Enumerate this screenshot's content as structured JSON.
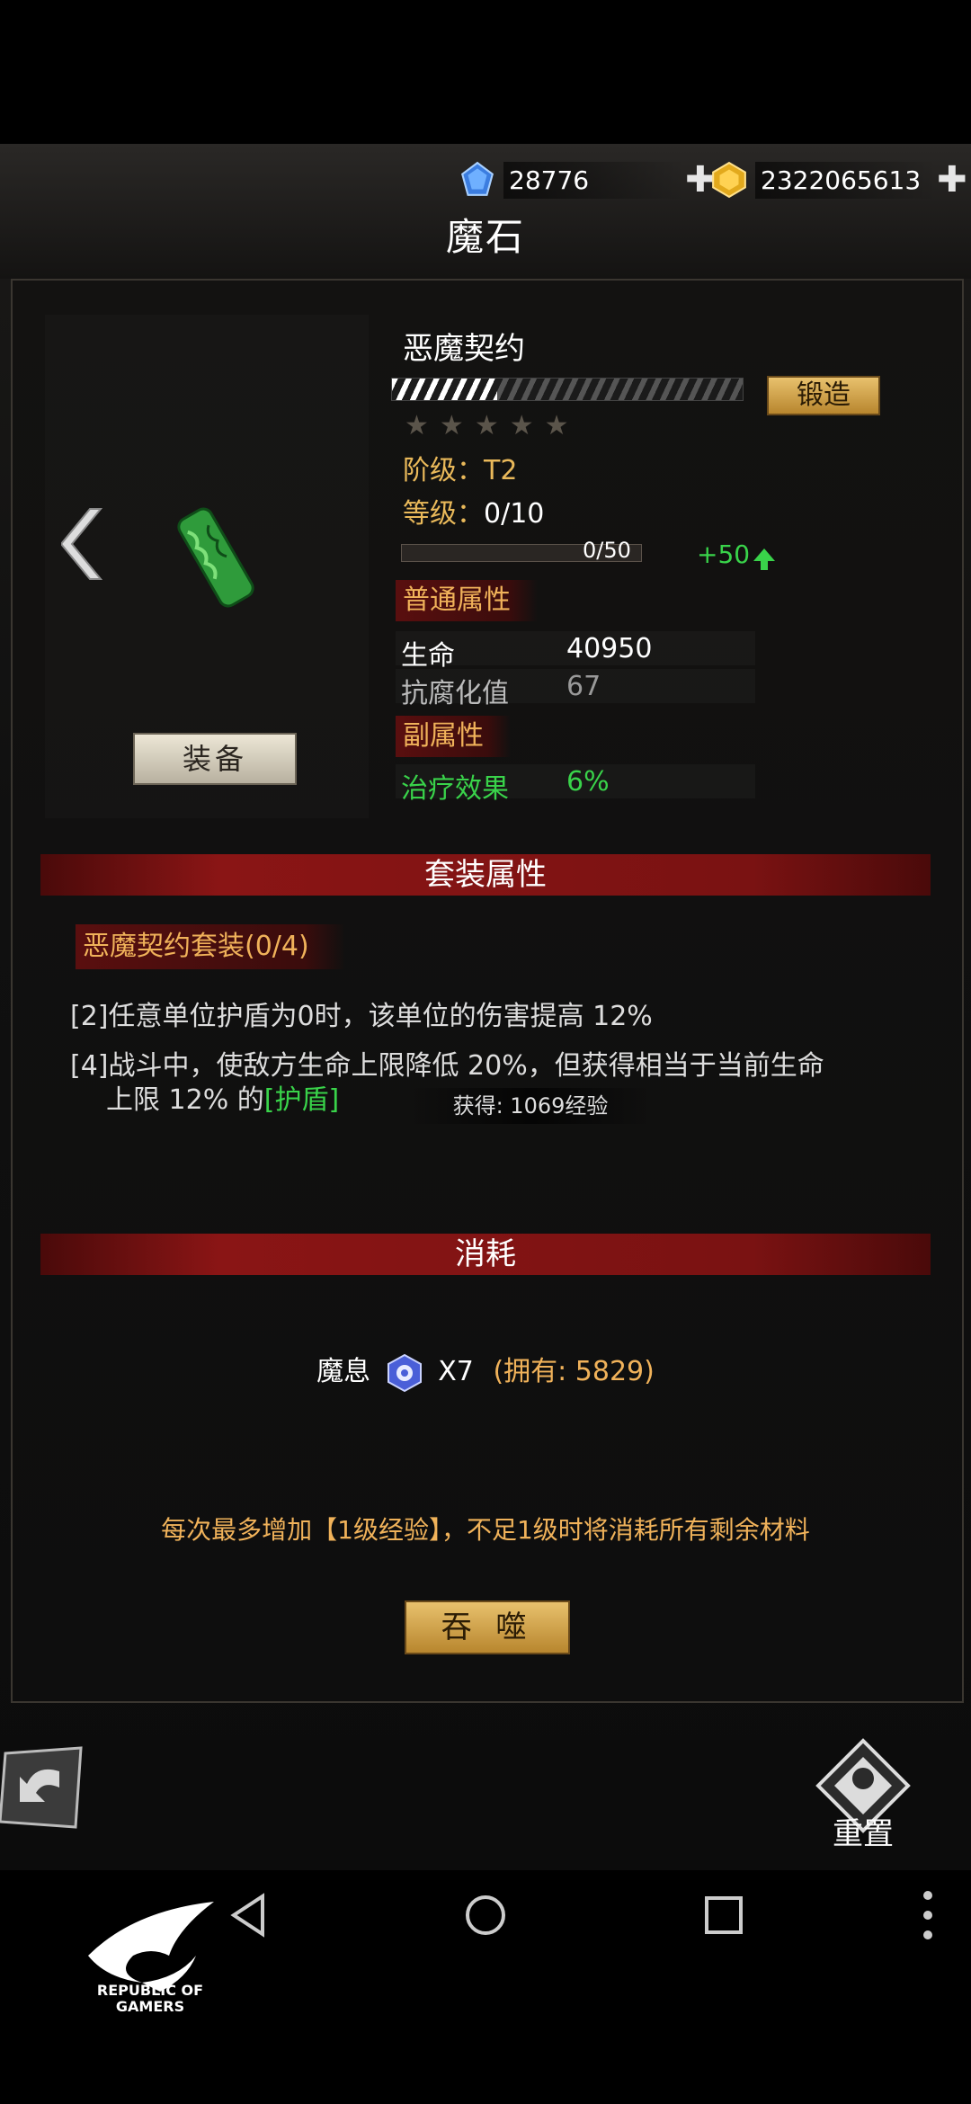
{
  "header": {
    "blue_gem_value": "28776",
    "gold_gem_value": "2322065613",
    "title": "魔石"
  },
  "item": {
    "name": "恶魔契约",
    "forge_label": "锻造",
    "tier_label": "阶级：",
    "tier_value": "T2",
    "level_label": "等级：",
    "level_value": "0/10",
    "xp_text": "0/50",
    "xp_progress": 0,
    "forge_progress": 0.3,
    "stars_total": 5,
    "xp_gain": "+50",
    "equip_label": "装备"
  },
  "attributes": {
    "normal_title": "普通属性",
    "normal": [
      {
        "key": "生命",
        "value": "40950"
      },
      {
        "key": "抗腐化值",
        "value": "67"
      }
    ],
    "sub_title": "副属性",
    "sub": [
      {
        "key": "治疗效果",
        "value": "6%"
      }
    ]
  },
  "set": {
    "section_title": "套装属性",
    "set_name": "恶魔契约套装(0/4)",
    "line1_prefix": "[2]",
    "line1": "任意单位护盾为0时，该单位的伤害提高 12%",
    "line2_prefix": "[4]",
    "line2a": "战斗中，使敌方生命上限降低 20%，但获得相当于当前生命",
    "line2b": "上限 12% 的",
    "line2_highlight": "[护盾]",
    "toast": "获得: 1069经验"
  },
  "cost": {
    "section_title": "消耗",
    "material": "魔息",
    "quantity": "X7",
    "owned": "(拥有: 5829)",
    "notice": "每次最多增加【1级经验】，不足1级时将消耗所有剩余材料",
    "devour_label": "吞 噬"
  },
  "footer": {
    "reset_label": "重置",
    "rog_text_1": "REPUBLIC OF",
    "rog_text_2": "GAMERS"
  }
}
